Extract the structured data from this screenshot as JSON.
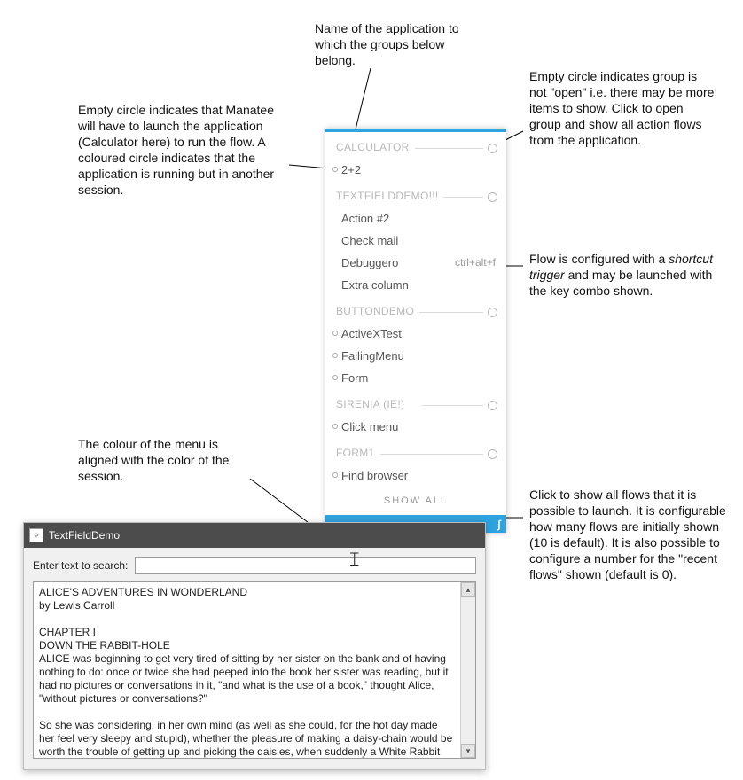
{
  "callouts": {
    "app_name": "Name of the application to which the groups below belong.",
    "launch_circle": "Empty circle indicates that Manatee will have to launch the application (Calculator here) to run the flow. A coloured circle indicates that the application is running but in another session.",
    "open_circle": "Empty circle indicates group is not \"open\" i.e. there may be more items to show. Click to open group and show all action flows from the application.",
    "shortcut": "Flow is configured with a shortcut trigger and may be launched with the key combo shown.",
    "menu_color": "The colour of the menu is aligned with the color of the session.",
    "show_all": "Click to show all flows that it is possible to launch. It is configurable how many flows are initially shown (10 is default). It is also possible to configure a number for the \"recent flows\" shown (default is 0)."
  },
  "callouts_shortcut_word": "shortcut trigger",
  "menu": {
    "groups": [
      {
        "title": "CALCULATOR",
        "open": false,
        "items": [
          {
            "label": "2+2",
            "circle": true
          }
        ]
      },
      {
        "title": "TEXTFIELDDEMO!!!",
        "open": false,
        "items": [
          {
            "label": "Action #2",
            "circle": false
          },
          {
            "label": "Check mail",
            "circle": false
          },
          {
            "label": "Debuggero",
            "circle": false,
            "shortcut": "ctrl+alt+f"
          },
          {
            "label": "Extra column",
            "circle": false
          }
        ]
      },
      {
        "title": "BUTTONDEMO",
        "open": false,
        "items": [
          {
            "label": "ActiveXTest",
            "circle": true
          },
          {
            "label": "FailingMenu",
            "circle": true
          },
          {
            "label": "Form",
            "circle": true
          }
        ]
      },
      {
        "title": "SIRENIA (IE!)",
        "open": false,
        "items": [
          {
            "label": "Click menu",
            "circle": true
          }
        ]
      },
      {
        "title": "FORM1",
        "open": false,
        "items": [
          {
            "label": "Find browser",
            "circle": true
          }
        ]
      }
    ],
    "show_all": "SHOW ALL"
  },
  "window": {
    "title": "TextFieldDemo",
    "search_label": "Enter text to search:",
    "search_value": "",
    "text": "ALICE'S ADVENTURES IN WONDERLAND\nby Lewis Carroll\n\nCHAPTER I\nDOWN THE RABBIT-HOLE\nALICE was beginning to get very tired of sitting by her sister on the bank and of having nothing to do: once or twice she had peeped into the book her sister was reading, but it had no pictures or conversations in it, \"and what is the use of a book,\" thought Alice, \"without pictures or conversations?\"\n\nSo she was considering, in her own mind (as well as she could, for the hot day made her feel very sleepy and stupid), whether the pleasure of making a daisy-chain would be worth the trouble of getting up and picking the daisies, when suddenly a White Rabbit with pink eyes ran close by her."
  }
}
